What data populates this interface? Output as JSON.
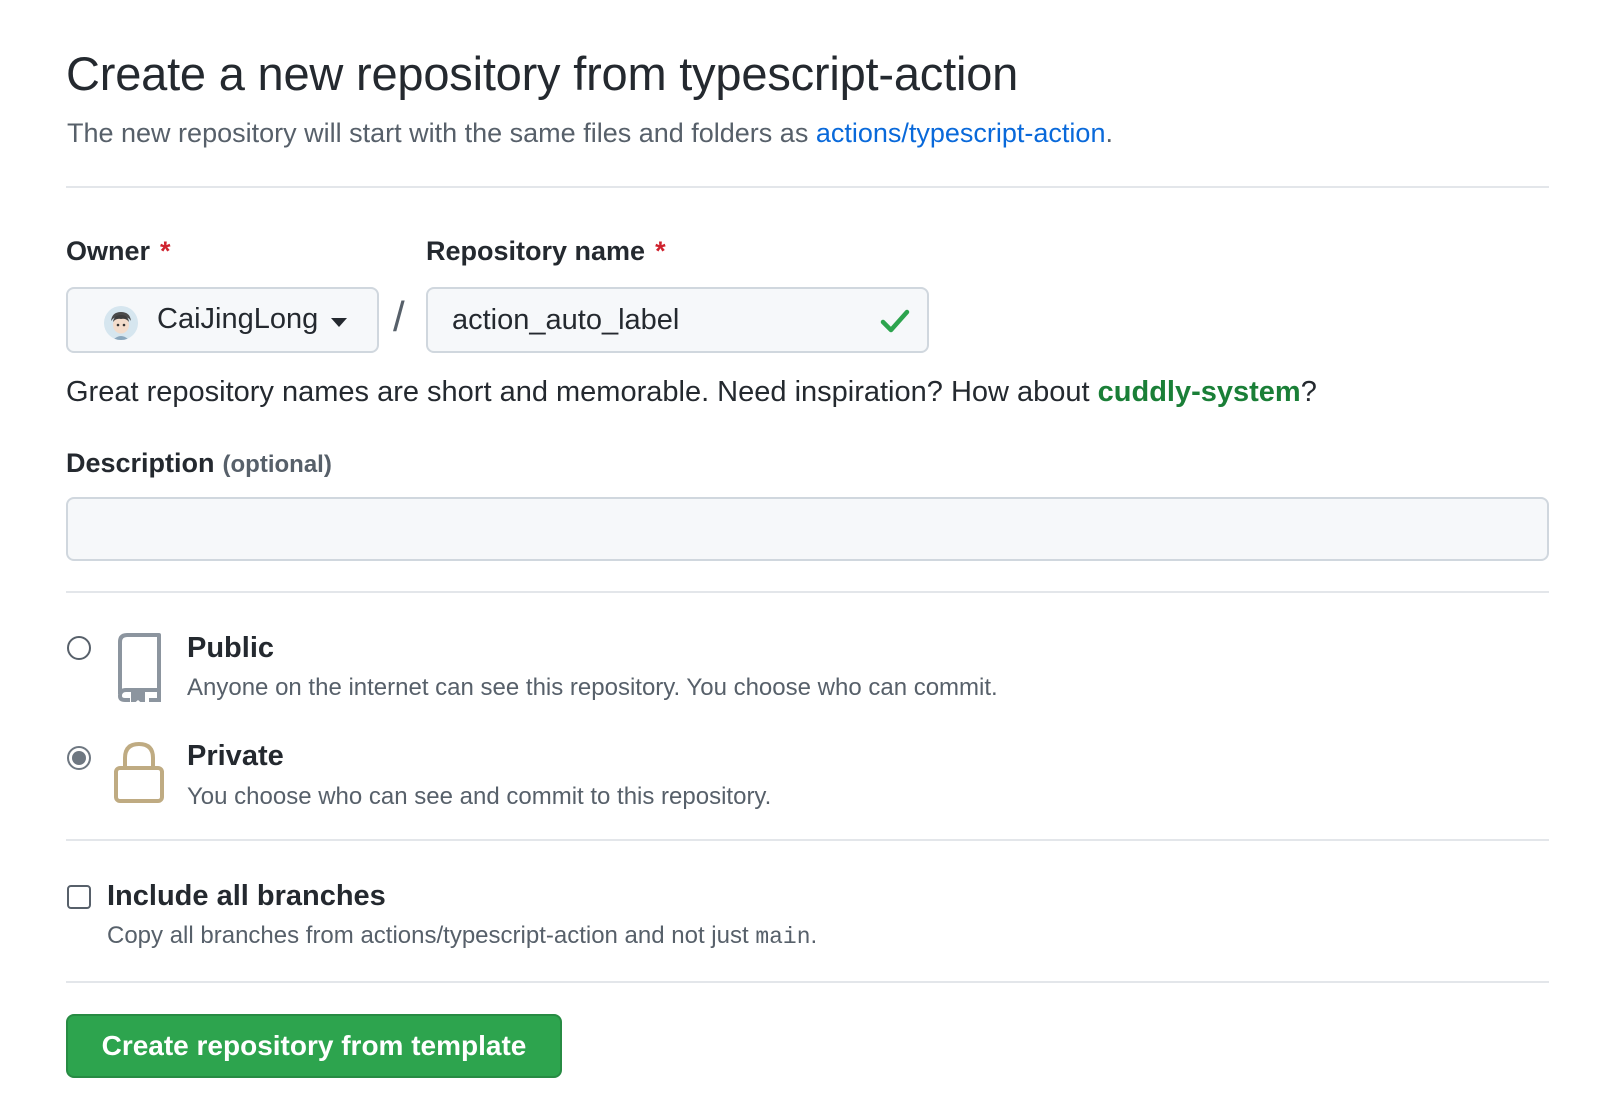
{
  "header": {
    "title": "Create a new repository from typescript-action",
    "subtitle_prefix": "The new repository will start with the same files and folders as ",
    "template_link": "actions/typescript-action",
    "subtitle_suffix": "."
  },
  "owner": {
    "label": "Owner",
    "required_mark": "*",
    "value": "CaiJingLong"
  },
  "separator": "/",
  "repo_name": {
    "label": "Repository name",
    "required_mark": "*",
    "value": "action_auto_label",
    "valid": true
  },
  "hint": {
    "prefix": "Great repository names are short and memorable. Need inspiration? How about ",
    "suggestion": "cuddly-system",
    "suffix": "?"
  },
  "description": {
    "label": "Description",
    "optional": "(optional)",
    "value": ""
  },
  "visibility": {
    "selected": "private",
    "options": [
      {
        "id": "public",
        "title": "Public",
        "desc": "Anyone on the internet can see this repository. You choose who can commit.",
        "icon": "repo-icon"
      },
      {
        "id": "private",
        "title": "Private",
        "desc": "You choose who can see and commit to this repository.",
        "icon": "lock-icon"
      }
    ]
  },
  "branches": {
    "label": "Include all branches",
    "desc_prefix": "Copy all branches from actions/typescript-action and not just ",
    "desc_code": "main",
    "desc_suffix": ".",
    "checked": false
  },
  "submit_label": "Create repository from template",
  "colors": {
    "accent_link": "#0969da",
    "success_green": "#2da44e",
    "suggestion_green": "#1a7f37",
    "required_red": "#cf222e",
    "lock_tan": "#bfab82"
  }
}
